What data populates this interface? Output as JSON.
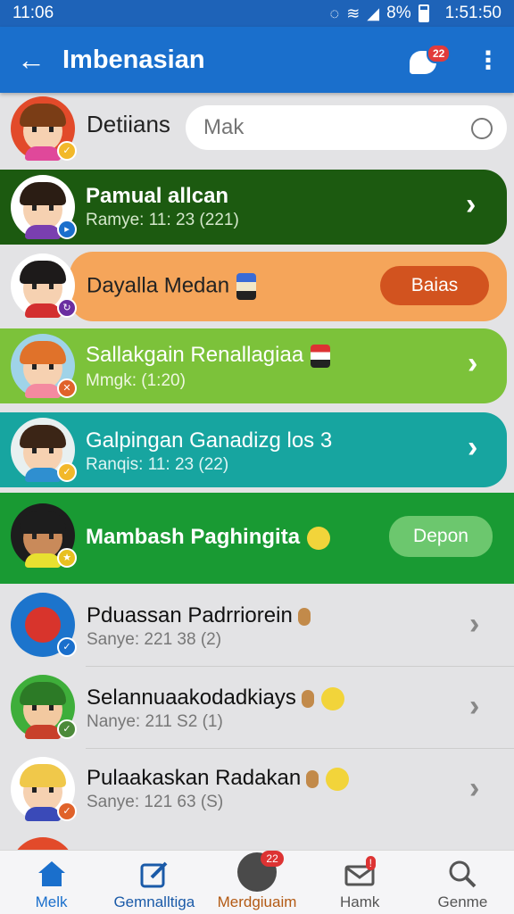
{
  "status_bar": {
    "time": "11:06",
    "battery": "8%",
    "clock": "1:51:50"
  },
  "header": {
    "title": "Imbenasian",
    "notification_count": "22"
  },
  "search": {
    "label": "Detiians",
    "placeholder": "Mak"
  },
  "items": [
    {
      "name": "Pamual allcan",
      "sub": "Ramye: 11: 23 (221)",
      "bg": "#1c5a10",
      "text": "#ffffff",
      "action": "chevron"
    },
    {
      "name": "Dayalla Medan",
      "sub": "",
      "bg": "#f5a55a",
      "text": "#222222",
      "action_label": "Baias",
      "action": "button"
    },
    {
      "name": "Sallakgain Renallagiaa",
      "sub": "Mmgk: (1:20)",
      "bg": "#7cc23a",
      "text": "#ffffff",
      "action": "chevron"
    },
    {
      "name": "Galpingan Ganadizg los 3",
      "sub": "Ranqis: 11: 23 (22)",
      "bg": "#17a5a0",
      "text": "#ffffff",
      "action": "chevron"
    },
    {
      "name": "Mambash Paghingita",
      "sub": "",
      "bg": "#199a33",
      "text": "#ffffff",
      "action_label": "Depon",
      "action": "button"
    },
    {
      "name": "Pduassan Padrriorein",
      "sub": "Sanye: 221 38 (2)",
      "action": "chevron"
    },
    {
      "name": "Selannuaakodadkiays",
      "sub": "Nanye: 211 S2 (1)",
      "action": "chevron"
    },
    {
      "name": "Pulaakaskan Radakan",
      "sub": "Sanye: 121 63 (S)",
      "action": "chevron"
    }
  ],
  "bottom_nav": [
    {
      "label": "Melk",
      "active": true,
      "color": "#1a6fcc"
    },
    {
      "label": "Gemnalltiga",
      "color": "#1a5aa8"
    },
    {
      "label": "Merdgiuaim",
      "color": "#b35a14",
      "badge": "22"
    },
    {
      "label": "Hamk",
      "color": "#555555",
      "badge": "!"
    },
    {
      "label": "Genme",
      "color": "#555555"
    }
  ],
  "colors": {
    "primary": "#1a6fcc",
    "status": "#1e63b8",
    "background": "#e3e3e5"
  }
}
